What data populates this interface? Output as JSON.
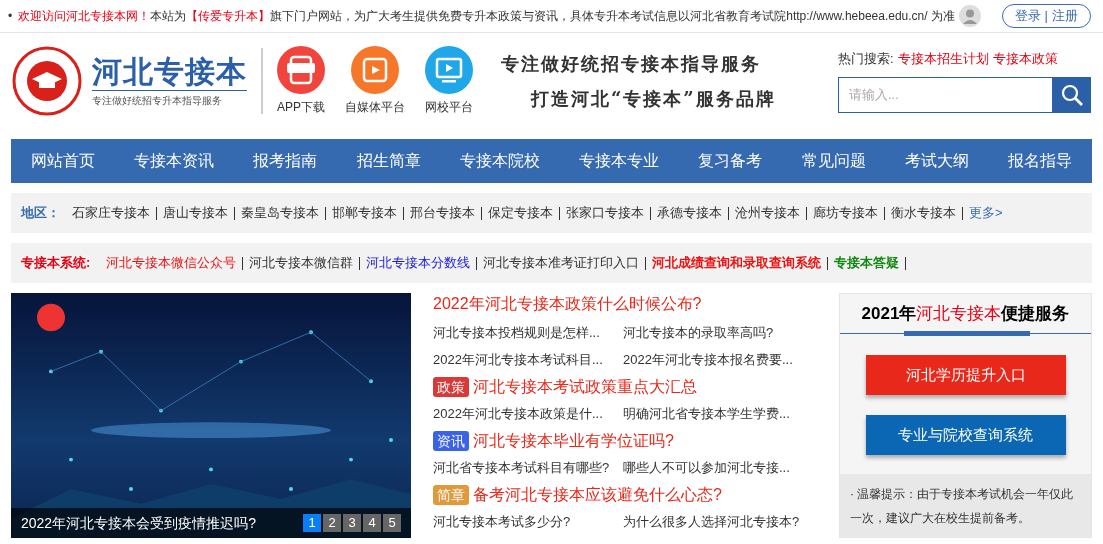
{
  "top_bar": {
    "bullet": "•",
    "notice": [
      {
        "text": "欢迎访问河北专接本网！",
        "kind": "highlight"
      },
      {
        "text": "本站为",
        "kind": "plain"
      },
      {
        "text": "【传爱专升本】",
        "kind": "highlight"
      },
      {
        "text": "旗下门户网站，为广大考生提供免费专升本政策与资讯，具体专升本考试信息以河北省教育考试院http://www.hebeea.edu.cn/ 为准",
        "kind": "plain"
      }
    ],
    "login": "登录",
    "separator": "|",
    "register": "注册"
  },
  "header": {
    "logo_title": "河北专接本",
    "logo_subtitle": "专注做好统招专升本指导服务",
    "apps": [
      {
        "label": "APP下载",
        "kind": "app",
        "color": "#f0443c"
      },
      {
        "label": "自媒体平台",
        "kind": "media",
        "color": "#f7772a"
      },
      {
        "label": "网校平台",
        "kind": "school",
        "color": "#1fa7ea"
      }
    ],
    "slogan": [
      "专注做好统招专接本指导服务",
      "打造河北“专接本”服务品牌"
    ],
    "hot_label": "热门搜索:",
    "hot_links": [
      "专接本招生计划",
      "专接本政策"
    ],
    "search": {
      "placeholder": "请输入..."
    }
  },
  "nav": [
    "网站首页",
    "专接本资讯",
    "报考指南",
    "招生简章",
    "专接本院校",
    "专接本专业",
    "复习备考",
    "常见问题",
    "考试大纲",
    "报名指导"
  ],
  "regions": {
    "label": "地区：",
    "items": [
      "石家庄专接本",
      "唐山专接本",
      "秦皇岛专接本",
      "邯郸专接本",
      "邢台专接本",
      "保定专接本",
      "张家口专接本",
      "承德专接本",
      "沧州专接本",
      "廊坊专接本",
      "衡水专接本"
    ],
    "more": "更多>"
  },
  "systems": {
    "label": "专接本系统:",
    "items": [
      {
        "text": "河北专接本微信公众号",
        "color": "#ee1111",
        "bold": false
      },
      {
        "text": "河北专接本微信群",
        "color": "#333333",
        "bold": false
      },
      {
        "text": "河北专接本分数线",
        "color": "#1a1ae6",
        "bold": false
      },
      {
        "text": "河北专接本准考证打印入口",
        "color": "#333333",
        "bold": false
      },
      {
        "text": "河北成绩查询和录取查询系统",
        "color": "#ee1111",
        "bold": true
      },
      {
        "text": "专接本答疑",
        "color": "#118811",
        "bold": true
      }
    ]
  },
  "slideshow": {
    "caption": "2022年河北专接本会受到疫情推迟吗?",
    "pages": [
      {
        "label": "1",
        "selected": true
      },
      {
        "label": "2",
        "selected": false
      },
      {
        "label": "3",
        "selected": false
      },
      {
        "label": "4",
        "selected": false
      },
      {
        "label": "5",
        "selected": false
      }
    ]
  },
  "news": [
    {
      "kind": "headline",
      "title": "2022年河北专接本政策什么时候公布?"
    },
    {
      "kind": "pair",
      "links": [
        "河北专接本投档规则是怎样...",
        "河北专接本的录取率高吗?"
      ]
    },
    {
      "kind": "pair",
      "links": [
        "2022年河北专接本考试科目...",
        "2022年河北专接本报名费要..."
      ]
    },
    {
      "kind": "tagged",
      "tag": "政策",
      "color": "#d83a37",
      "title": "河北专接本考试政策重点大汇总"
    },
    {
      "kind": "pair",
      "links": [
        "2022年河北专接本政策是什...",
        "明确河北省专接本学生学费..."
      ]
    },
    {
      "kind": "tagged",
      "tag": "资讯",
      "color": "#3a63e8",
      "title": "河北专接本毕业有学位证吗?"
    },
    {
      "kind": "pair",
      "links": [
        "河北省专接本考试科目有哪些?",
        "哪些人不可以参加河北专接..."
      ]
    },
    {
      "kind": "tagged",
      "tag": "简章",
      "color": "#e09a3c",
      "title": "备考河北专接本应该避免什么心态?"
    },
    {
      "kind": "pair",
      "links": [
        "河北专接本考试多少分?",
        "为什么很多人选择河北专接本?"
      ]
    }
  ],
  "services": {
    "title": "2021年**河北专接本**便捷服务",
    "buttons": [
      {
        "label": "河北学历提升入口",
        "color": "#e8281a"
      },
      {
        "label": "专业与院校查询系统",
        "color": "#0b67b4"
      }
    ],
    "tip": "· 温馨提示：由于专接本考试机会一年仅此一次，建议广大在校生提前备考。"
  }
}
